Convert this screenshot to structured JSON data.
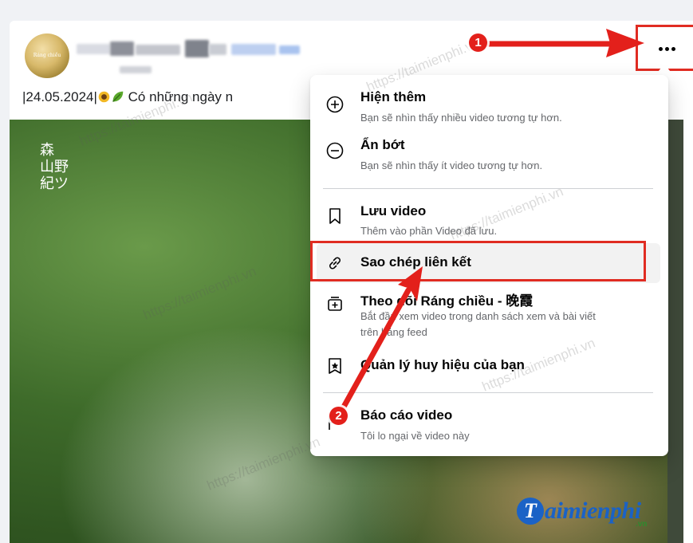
{
  "post": {
    "avatar_text": "Ráng chiều",
    "caption_date": "|24.05.2024|",
    "caption_text": "Có những ngày n"
  },
  "video": {
    "seal_text": "森\n山野\n紀ツ"
  },
  "more_button": {
    "icon": "more-dots-icon",
    "step_badge": "1"
  },
  "menu": {
    "items": [
      {
        "icon": "plus-circle-icon",
        "title": "Hiện thêm",
        "subtitle": "Bạn sẽ nhìn thấy nhiều video tương tự hơn."
      },
      {
        "icon": "minus-circle-icon",
        "title": "Ẩn bớt",
        "subtitle": "Bạn sẽ nhìn thấy ít video tương tự hơn."
      },
      {
        "icon": "bookmark-icon",
        "title": "Lưu video",
        "subtitle": "Thêm vào phần Video đã lưu."
      },
      {
        "icon": "link-icon",
        "title": "Sao chép liên kết",
        "subtitle": ""
      },
      {
        "icon": "add-to-watchlist-icon",
        "title": "Theo dõi Ráng chiều - 晚霞",
        "subtitle_line1": "Bắt đầu xem video trong danh sách xem và bài viết",
        "subtitle_line2": "trên bảng feed"
      },
      {
        "icon": "badge-star-icon",
        "title": "Quản lý huy hiệu của bạn",
        "subtitle": ""
      },
      {
        "icon": "report-flag-icon",
        "title": "Báo cáo video",
        "subtitle": "Tôi lo ngại về video này"
      }
    ],
    "step_badge": "2"
  },
  "logo": {
    "letter": "T",
    "text": "aimienphi",
    "suffix": ".vn"
  },
  "watermark": "https://taimienphi.vn",
  "colors": {
    "highlight": "#e02c22",
    "badge": "#e3201b",
    "logo_blue": "#1a62c6"
  }
}
